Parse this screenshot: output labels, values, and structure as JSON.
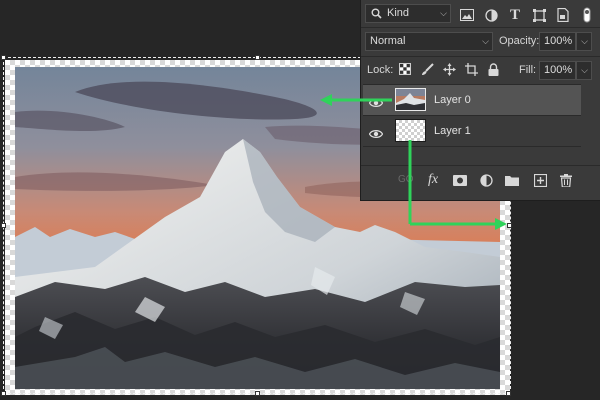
{
  "app": "Photoshop",
  "panel": {
    "filter": {
      "label": "Kind",
      "icon": "search-icon"
    },
    "filter_icons": [
      "image-filter-icon",
      "adjustment-filter-icon",
      "type-filter-icon",
      "shape-filter-icon",
      "smart-object-filter-icon",
      "filter-toggle-icon"
    ],
    "blend_mode": "Normal",
    "opacity": {
      "label": "Opacity:",
      "value": "100%"
    },
    "lock": {
      "label": "Lock:",
      "icons": [
        "lock-transparent-icon",
        "lock-image-icon",
        "lock-position-icon",
        "lock-artboard-icon",
        "lock-all-icon"
      ]
    },
    "fill": {
      "label": "Fill:",
      "value": "100%"
    },
    "layers": [
      {
        "name": "Layer 0",
        "visible": true,
        "selected": true,
        "thumbnail": "mountain-photo"
      },
      {
        "name": "Layer 1",
        "visible": true,
        "selected": false,
        "thumbnail": "transparent"
      }
    ],
    "footer_icons": [
      "link-layers-icon",
      "fx-icon",
      "mask-icon",
      "adjustment-layer-icon",
      "group-folder-icon",
      "new-layer-icon",
      "trash-icon"
    ],
    "footer_fx": "fx",
    "footer_link_label": "GO"
  },
  "colors": {
    "annotation_arrow": "#2fd35a",
    "panel_bg": "#3a3a3a",
    "selected_layer": "#545454",
    "workspace": "#262626"
  }
}
